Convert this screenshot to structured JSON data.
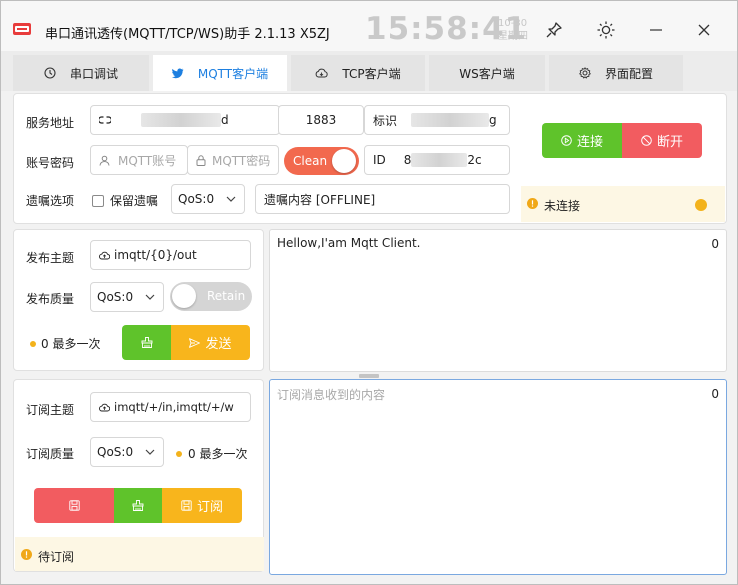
{
  "title": "串口通讯透传(MQTT/TCP/WS)助手 2.1.13 X5ZJ",
  "clock": {
    "time": "15:58:41",
    "date": "10-30",
    "weekday": "星期四"
  },
  "tabs": [
    {
      "label": "串口调试",
      "icon": "clock-icon"
    },
    {
      "label": "MQTT客户端",
      "icon": "bird-icon",
      "active": true
    },
    {
      "label": "TCP客户端",
      "icon": "cloud-icon"
    },
    {
      "label": "WS客户端",
      "icon": ""
    },
    {
      "label": "界面配置",
      "icon": "gear-icon"
    }
  ],
  "connection": {
    "server_label": "服务地址",
    "server_value_suffix": "d",
    "port": "1883",
    "ident_label": "标识",
    "ident_value_suffix": "g",
    "account_label": "账号密码",
    "account_placeholder": "MQTT账号",
    "password_placeholder": "MQTT密码",
    "clean_label": "Clean",
    "id_label": "ID",
    "id_value_prefix": "8",
    "id_value_suffix": "2c",
    "will_label": "遗嘱选项",
    "retain_will_label": "保留遗嘱",
    "will_qos": "QoS:0",
    "will_content": "遗嘱内容 [OFFLINE]",
    "connect_button": "连接",
    "disconnect_button": "断开",
    "status": "未连接"
  },
  "publish": {
    "topic_label": "发布主题",
    "topic_value": "imqtt/{0}/out",
    "qos_label": "发布质量",
    "qos_value": "QoS:0",
    "retain_label": "Retain",
    "qos_desc": "0 最多一次",
    "send_button": "发送",
    "message": "Hellow,I'am Mqtt Client.",
    "message_count": "0"
  },
  "subscribe": {
    "topic_label": "订阅主题",
    "topic_value": "imqtt/+/in,imqtt/+/w",
    "qos_label": "订阅质量",
    "qos_value": "QoS:0",
    "qos_desc": "0 最多一次",
    "subscribe_button": "订阅",
    "status": "待订阅",
    "placeholder": "订阅消息收到的内容",
    "message_count": "0"
  },
  "colors": {
    "accent": "#1d7fe0",
    "green": "#5fc32b",
    "red": "#f25c60",
    "orange": "#f8b51c",
    "clean_on": "#f2694e"
  }
}
